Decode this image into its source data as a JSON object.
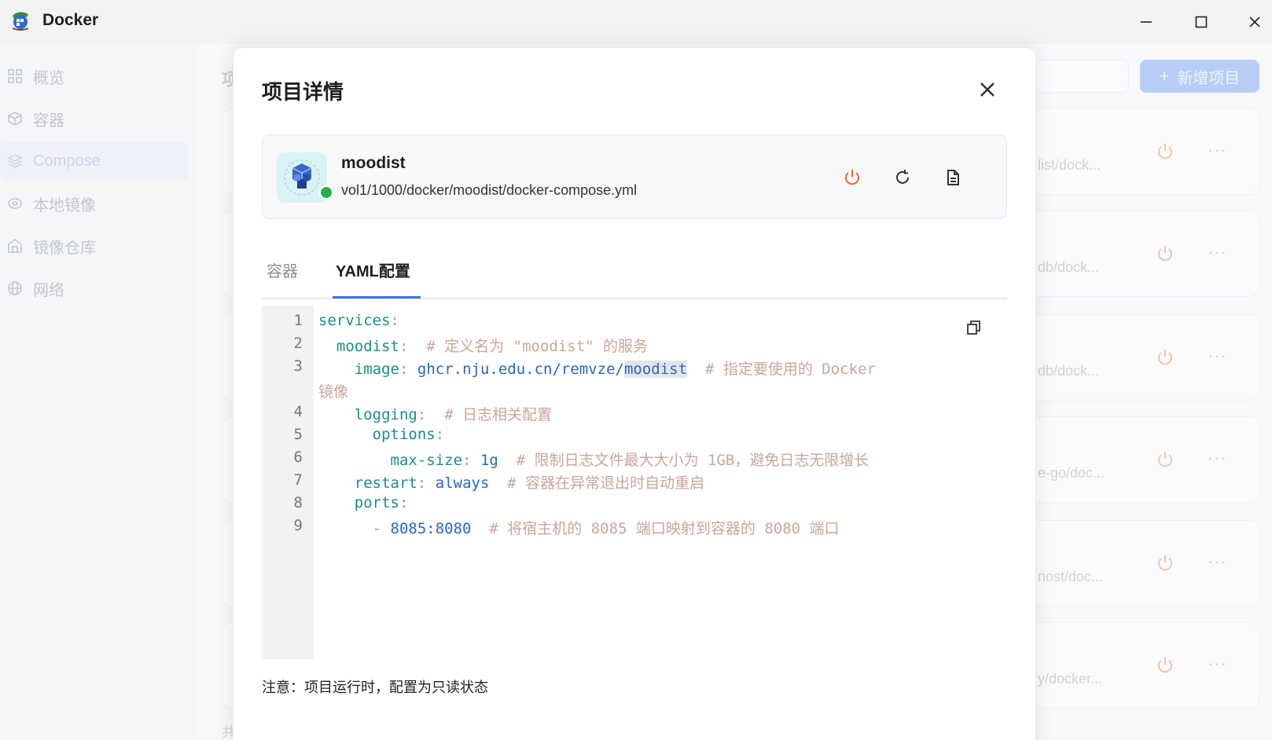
{
  "window": {
    "title": "Docker",
    "logo_icon": "docker-whale-icon",
    "controls": [
      "minimize-icon",
      "maximize-icon",
      "close-icon"
    ]
  },
  "sidebar": {
    "items": [
      {
        "label": "概览",
        "icon": "grid-icon"
      },
      {
        "label": "容器",
        "icon": "cube-icon"
      },
      {
        "label": "Compose",
        "icon": "layers-icon",
        "active": true
      },
      {
        "label": "本地镜像",
        "icon": "disk-icon"
      },
      {
        "label": "镜像仓库",
        "icon": "warehouse-icon"
      },
      {
        "label": "网络",
        "icon": "globe-icon"
      }
    ]
  },
  "background": {
    "page_title": "项",
    "footer": "共",
    "add_button": "新增项目",
    "rows": [
      {
        "path": "list/dock..."
      },
      {
        "path": "db/dock..."
      },
      {
        "path": "db/dock..."
      },
      {
        "path": "e-go/doc..."
      },
      {
        "path": "nost/doc..."
      },
      {
        "path": "y/docker..."
      }
    ],
    "more_glyph": "···"
  },
  "modal": {
    "title": "项目详情",
    "project": {
      "name": "moodist",
      "path": "vol1/1000/docker/moodist/docker-compose.yml",
      "status": "running",
      "status_color": "#22b14c"
    },
    "tabs": [
      {
        "label": "容器"
      },
      {
        "label": "YAML配置",
        "active": true
      }
    ],
    "code": {
      "line_numbers": [
        "1",
        "2",
        "3",
        "4",
        "5",
        "6",
        "7",
        "8",
        "9"
      ],
      "l1_key": "services",
      "l2_key": "moodist",
      "l2_comment": "# 定义名为 \"moodist\" 的服务",
      "l3_key": "image",
      "l3_val_a": "ghcr.nju.edu.cn/remvze/",
      "l3_val_b": "moodist",
      "l3_comment": "# 指定要使用的 Docker",
      "l3_comment_wrap": "镜像",
      "l4_key": "logging",
      "l4_comment": "# 日志相关配置",
      "l5_key": "options",
      "l6_key": "max-size",
      "l6_val": "1g",
      "l6_comment": "# 限制日志文件最大大小为 1GB，避免日志无限增长",
      "l7_key": "restart",
      "l7_val": "always",
      "l7_comment": "# 容器在异常退出时自动重启",
      "l8_key": "ports",
      "l9_dash": "-",
      "l9_val": "8085:8080",
      "l9_comment": "# 将宿主机的 8085 端口映射到容器的 8080 端口"
    },
    "note": "注意：项目运行时，配置为只读状态"
  },
  "colors": {
    "accent": "#3b73e6",
    "power": "#e8692a",
    "yaml_key": "#1a8f88",
    "yaml_value": "#2a66c4",
    "yaml_comment": "#c8a69a"
  }
}
